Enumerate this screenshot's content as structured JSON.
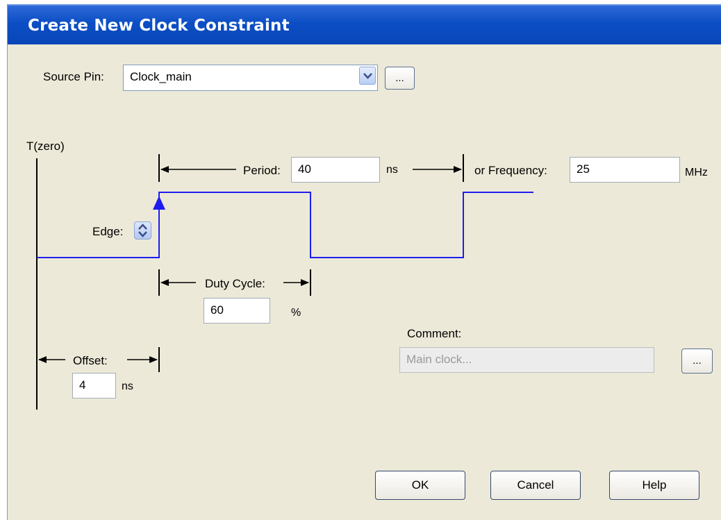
{
  "dialog": {
    "title": "Create New Clock Constraint"
  },
  "source_pin": {
    "label": "Source Pin:",
    "value": "Clock_main",
    "browse_label": "..."
  },
  "timing": {
    "t_zero_label": "T(zero)",
    "period_label": "Period:",
    "period_value": "40",
    "period_unit": "ns",
    "frequency_label": "or Frequency:",
    "frequency_value": "25",
    "frequency_unit": "MHz",
    "edge_label": "Edge:",
    "duty_cycle_label": "Duty Cycle:",
    "duty_cycle_value": "60",
    "duty_cycle_unit": "%",
    "offset_label": "Offset:",
    "offset_value": "4",
    "offset_unit": "ns"
  },
  "comment": {
    "label": "Comment:",
    "placeholder": "Main clock...",
    "browse_label": "..."
  },
  "buttons": {
    "ok": "OK",
    "cancel": "Cancel",
    "help": "Help"
  },
  "colors": {
    "titlebar": "#0b4ec4",
    "waveform": "#1d1df0",
    "dialog_bg": "#ece9d8"
  }
}
